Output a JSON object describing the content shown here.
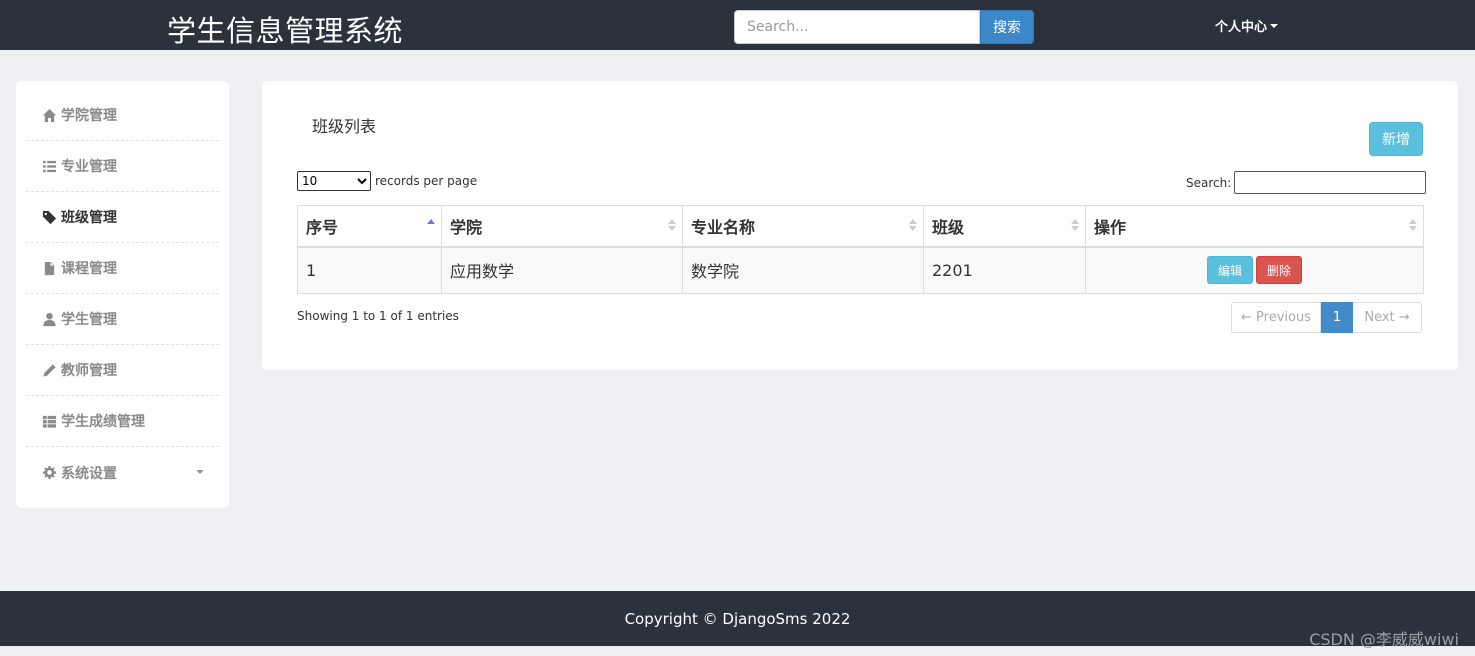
{
  "header": {
    "brand": "学生信息管理系统",
    "search_placeholder": "Search...",
    "search_button": "搜索",
    "user_menu": "个人中心"
  },
  "sidebar": {
    "items": [
      {
        "label": "学院管理",
        "icon": "home-icon"
      },
      {
        "label": "专业管理",
        "icon": "list-icon"
      },
      {
        "label": "班级管理",
        "icon": "tag-icon",
        "active": true
      },
      {
        "label": "课程管理",
        "icon": "file-icon"
      },
      {
        "label": "学生管理",
        "icon": "user-icon"
      },
      {
        "label": "教师管理",
        "icon": "pencil-icon"
      },
      {
        "label": "学生成绩管理",
        "icon": "th-list-icon"
      },
      {
        "label": "系统设置",
        "icon": "gear-icon"
      }
    ]
  },
  "main": {
    "title": "班级列表",
    "add_button": "新增",
    "length_label": "records per page",
    "length_value": "10",
    "filter_label": "Search:",
    "columns": [
      "序号",
      "学院",
      "专业名称",
      "班级",
      "操作"
    ],
    "rows": [
      {
        "index": "1",
        "college": "应用数学",
        "major": "数学院",
        "class": "2201"
      }
    ],
    "edit_label": "编辑",
    "delete_label": "删除",
    "info": "Showing 1 to 1 of 1 entries",
    "pager": {
      "prev": "← Previous",
      "page": "1",
      "next": "Next →"
    }
  },
  "footer": {
    "copyright": "Copyright © DjangoSms 2022",
    "watermark": "CSDN @李威威wiwi"
  },
  "colors": {
    "topbar": "#2b323c",
    "primary": "#428bca",
    "info": "#5bc0de",
    "danger": "#d9534f"
  }
}
